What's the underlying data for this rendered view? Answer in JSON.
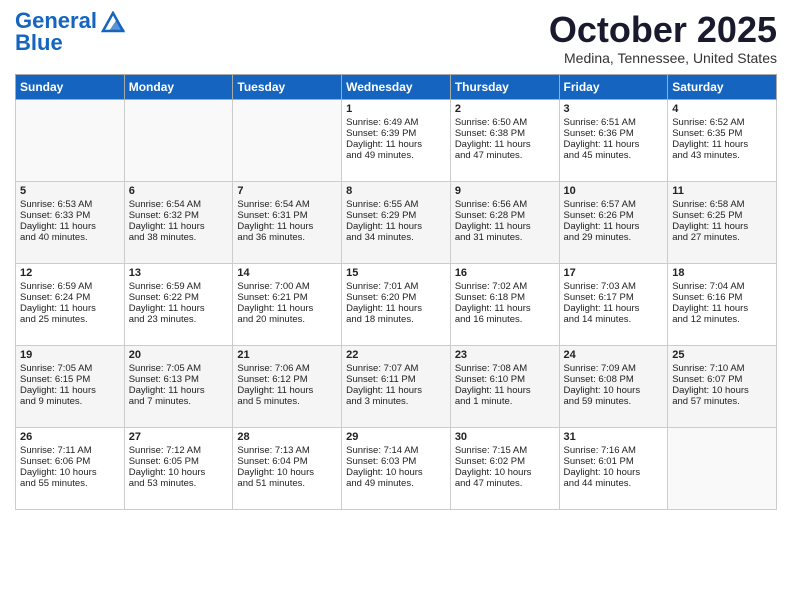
{
  "header": {
    "logo_line1": "General",
    "logo_line2": "Blue",
    "month": "October 2025",
    "location": "Medina, Tennessee, United States"
  },
  "days_of_week": [
    "Sunday",
    "Monday",
    "Tuesday",
    "Wednesday",
    "Thursday",
    "Friday",
    "Saturday"
  ],
  "weeks": [
    [
      {
        "day": "",
        "content": ""
      },
      {
        "day": "",
        "content": ""
      },
      {
        "day": "",
        "content": ""
      },
      {
        "day": "1",
        "content": "Sunrise: 6:49 AM\nSunset: 6:39 PM\nDaylight: 11 hours\nand 49 minutes."
      },
      {
        "day": "2",
        "content": "Sunrise: 6:50 AM\nSunset: 6:38 PM\nDaylight: 11 hours\nand 47 minutes."
      },
      {
        "day": "3",
        "content": "Sunrise: 6:51 AM\nSunset: 6:36 PM\nDaylight: 11 hours\nand 45 minutes."
      },
      {
        "day": "4",
        "content": "Sunrise: 6:52 AM\nSunset: 6:35 PM\nDaylight: 11 hours\nand 43 minutes."
      }
    ],
    [
      {
        "day": "5",
        "content": "Sunrise: 6:53 AM\nSunset: 6:33 PM\nDaylight: 11 hours\nand 40 minutes."
      },
      {
        "day": "6",
        "content": "Sunrise: 6:54 AM\nSunset: 6:32 PM\nDaylight: 11 hours\nand 38 minutes."
      },
      {
        "day": "7",
        "content": "Sunrise: 6:54 AM\nSunset: 6:31 PM\nDaylight: 11 hours\nand 36 minutes."
      },
      {
        "day": "8",
        "content": "Sunrise: 6:55 AM\nSunset: 6:29 PM\nDaylight: 11 hours\nand 34 minutes."
      },
      {
        "day": "9",
        "content": "Sunrise: 6:56 AM\nSunset: 6:28 PM\nDaylight: 11 hours\nand 31 minutes."
      },
      {
        "day": "10",
        "content": "Sunrise: 6:57 AM\nSunset: 6:26 PM\nDaylight: 11 hours\nand 29 minutes."
      },
      {
        "day": "11",
        "content": "Sunrise: 6:58 AM\nSunset: 6:25 PM\nDaylight: 11 hours\nand 27 minutes."
      }
    ],
    [
      {
        "day": "12",
        "content": "Sunrise: 6:59 AM\nSunset: 6:24 PM\nDaylight: 11 hours\nand 25 minutes."
      },
      {
        "day": "13",
        "content": "Sunrise: 6:59 AM\nSunset: 6:22 PM\nDaylight: 11 hours\nand 23 minutes."
      },
      {
        "day": "14",
        "content": "Sunrise: 7:00 AM\nSunset: 6:21 PM\nDaylight: 11 hours\nand 20 minutes."
      },
      {
        "day": "15",
        "content": "Sunrise: 7:01 AM\nSunset: 6:20 PM\nDaylight: 11 hours\nand 18 minutes."
      },
      {
        "day": "16",
        "content": "Sunrise: 7:02 AM\nSunset: 6:18 PM\nDaylight: 11 hours\nand 16 minutes."
      },
      {
        "day": "17",
        "content": "Sunrise: 7:03 AM\nSunset: 6:17 PM\nDaylight: 11 hours\nand 14 minutes."
      },
      {
        "day": "18",
        "content": "Sunrise: 7:04 AM\nSunset: 6:16 PM\nDaylight: 11 hours\nand 12 minutes."
      }
    ],
    [
      {
        "day": "19",
        "content": "Sunrise: 7:05 AM\nSunset: 6:15 PM\nDaylight: 11 hours\nand 9 minutes."
      },
      {
        "day": "20",
        "content": "Sunrise: 7:05 AM\nSunset: 6:13 PM\nDaylight: 11 hours\nand 7 minutes."
      },
      {
        "day": "21",
        "content": "Sunrise: 7:06 AM\nSunset: 6:12 PM\nDaylight: 11 hours\nand 5 minutes."
      },
      {
        "day": "22",
        "content": "Sunrise: 7:07 AM\nSunset: 6:11 PM\nDaylight: 11 hours\nand 3 minutes."
      },
      {
        "day": "23",
        "content": "Sunrise: 7:08 AM\nSunset: 6:10 PM\nDaylight: 11 hours\nand 1 minute."
      },
      {
        "day": "24",
        "content": "Sunrise: 7:09 AM\nSunset: 6:08 PM\nDaylight: 10 hours\nand 59 minutes."
      },
      {
        "day": "25",
        "content": "Sunrise: 7:10 AM\nSunset: 6:07 PM\nDaylight: 10 hours\nand 57 minutes."
      }
    ],
    [
      {
        "day": "26",
        "content": "Sunrise: 7:11 AM\nSunset: 6:06 PM\nDaylight: 10 hours\nand 55 minutes."
      },
      {
        "day": "27",
        "content": "Sunrise: 7:12 AM\nSunset: 6:05 PM\nDaylight: 10 hours\nand 53 minutes."
      },
      {
        "day": "28",
        "content": "Sunrise: 7:13 AM\nSunset: 6:04 PM\nDaylight: 10 hours\nand 51 minutes."
      },
      {
        "day": "29",
        "content": "Sunrise: 7:14 AM\nSunset: 6:03 PM\nDaylight: 10 hours\nand 49 minutes."
      },
      {
        "day": "30",
        "content": "Sunrise: 7:15 AM\nSunset: 6:02 PM\nDaylight: 10 hours\nand 47 minutes."
      },
      {
        "day": "31",
        "content": "Sunrise: 7:16 AM\nSunset: 6:01 PM\nDaylight: 10 hours\nand 44 minutes."
      },
      {
        "day": "",
        "content": ""
      }
    ]
  ]
}
